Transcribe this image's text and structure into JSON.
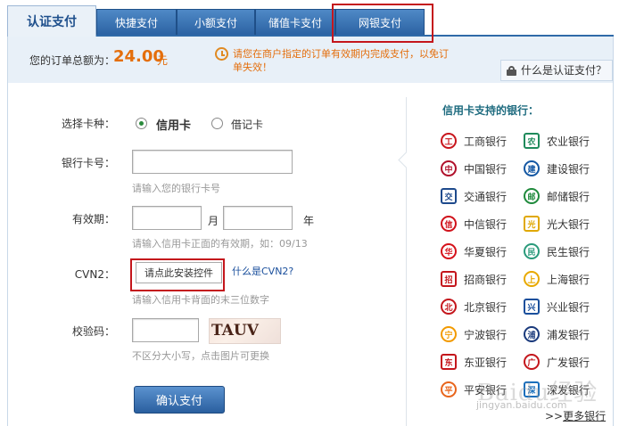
{
  "tabs": [
    {
      "label": "认证支付",
      "active": true
    },
    {
      "label": "快捷支付",
      "active": false
    },
    {
      "label": "小额支付",
      "active": false
    },
    {
      "label": "储值卡支付",
      "active": false
    },
    {
      "label": "网银支付",
      "active": false
    }
  ],
  "summary": {
    "amount_label": "您的订单总额为：",
    "amount": "24.00",
    "currency": "元",
    "notice": "请您在商户指定的订单有效期内完成支付，以免订单失效！",
    "whatis_label": "什么是认证支付？"
  },
  "form": {
    "card_type_label": "选择卡种：",
    "card_type_options": [
      "信用卡",
      "借记卡"
    ],
    "card_number_label": "银行卡号：",
    "card_number_value": "",
    "card_number_hint": "请输入您的银行卡号",
    "expiry_label": "有效期：",
    "expiry_month_unit": "月",
    "expiry_year_unit": "年",
    "expiry_hint": "请输入信用卡正面的有效期，如：09/13",
    "cvn_label": "CVN2：",
    "cvn_button": "请点此安装控件",
    "cvn_link": "什么是CVN2?",
    "cvn_hint": "请输入信用卡背面的末三位数字",
    "captcha_label": "校验码：",
    "captcha_text": "TAUV",
    "captcha_hint": "不区分大小写，点击图片可更换",
    "submit": "确认支付"
  },
  "banks": {
    "title": "信用卡支持的银行：",
    "items": [
      {
        "name": "工商银行",
        "color": "#c8161d"
      },
      {
        "name": "农业银行",
        "color": "#1f8a5b"
      },
      {
        "name": "中国银行",
        "color": "#b0102b"
      },
      {
        "name": "建设银行",
        "color": "#1357a3"
      },
      {
        "name": "交通银行",
        "color": "#1e4a8c"
      },
      {
        "name": "邮储银行",
        "color": "#1f8a3c"
      },
      {
        "name": "中信银行",
        "color": "#d0121b"
      },
      {
        "name": "光大银行",
        "color": "#e0a800"
      },
      {
        "name": "华夏银行",
        "color": "#d5121b"
      },
      {
        "name": "民生银行",
        "color": "#2a9a7b"
      },
      {
        "name": "招商银行",
        "color": "#c4161c"
      },
      {
        "name": "上海银行",
        "color": "#e8a900"
      },
      {
        "name": "北京银行",
        "color": "#c4161c"
      },
      {
        "name": "兴业银行",
        "color": "#1a4f9c"
      },
      {
        "name": "宁波银行",
        "color": "#f29a00"
      },
      {
        "name": "浦发银行",
        "color": "#1a3a7c"
      },
      {
        "name": "东亚银行",
        "color": "#c4161c"
      },
      {
        "name": "广发银行",
        "color": "#c4161c"
      },
      {
        "name": "平安银行",
        "color": "#e8651c"
      },
      {
        "name": "深发银行",
        "color": "#1a6fbc"
      }
    ],
    "more": "更多银行",
    "more_prefix": ">>"
  },
  "watermark": {
    "text": "Baidu经验",
    "url": "jingyan.baidu.com"
  },
  "colors": {
    "accent": "#2f6aa8",
    "highlight": "#c4161c",
    "orange": "#e46e0c"
  }
}
